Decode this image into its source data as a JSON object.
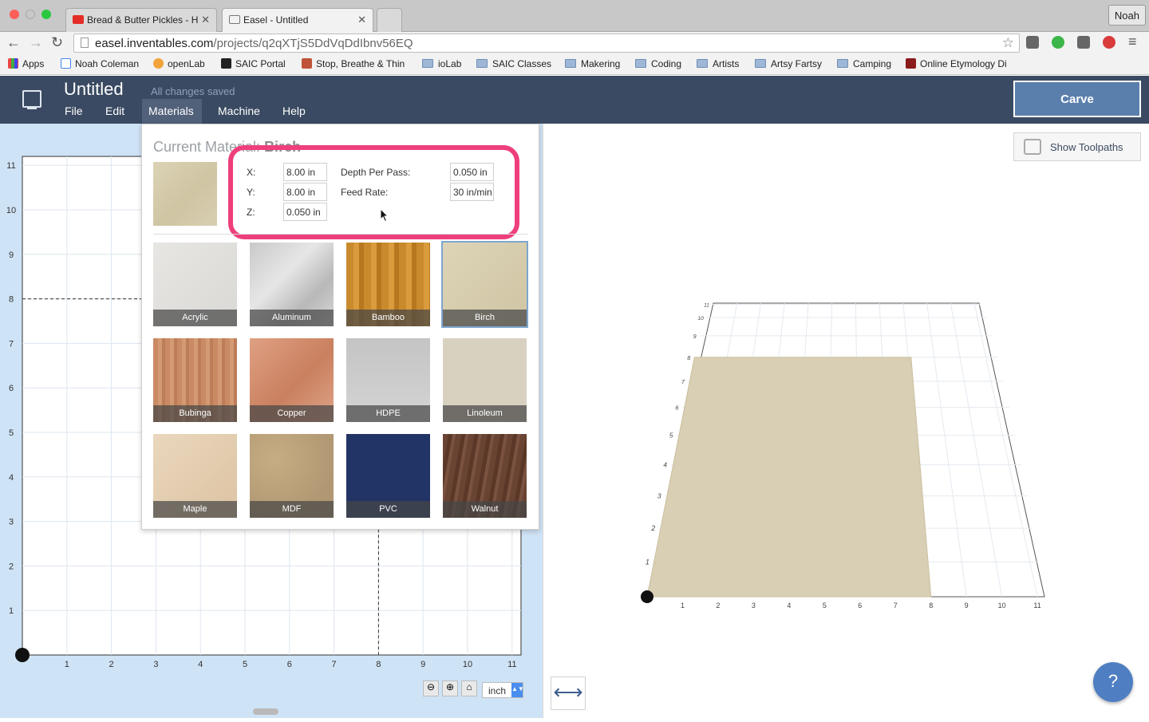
{
  "browser": {
    "tabs": [
      {
        "label": "Bread & Butter Pickles - H",
        "icon_color": "#e52d27"
      },
      {
        "label": "Easel - Untitled"
      }
    ],
    "profile": "Noah",
    "url": {
      "host": "easel.inventables.com",
      "path": "/projects/q2qXTjS5DdVqDdIbnv56EQ"
    },
    "bookmarks": [
      "Apps",
      "Noah Coleman",
      "openLab",
      "SAIC Portal",
      "Stop, Breathe & Thin",
      "ioLab",
      "SAIC Classes",
      "Makering",
      "Coding",
      "Artists",
      "Artsy Fartsy",
      "Camping",
      "Online Etymology Di"
    ]
  },
  "app": {
    "title": "Untitled",
    "save_status": "All changes saved",
    "menu": [
      "File",
      "Edit",
      "Materials",
      "Machine",
      "Help"
    ],
    "carve_label": "Carve",
    "accent": "#3a4a62"
  },
  "materials_panel": {
    "current_label": "Current Material:",
    "current_value": "Birch",
    "fields": {
      "x_label": "X:",
      "x_value": "8.00 in",
      "y_label": "Y:",
      "y_value": "8.00 in",
      "z_label": "Z:",
      "z_value": "0.050 in",
      "depth_label": "Depth Per Pass:",
      "depth_value": "0.050 in",
      "feed_label": "Feed Rate:",
      "feed_value": "30 in/min"
    },
    "materials": [
      "Acrylic",
      "Aluminum",
      "Bamboo",
      "Birch",
      "Bubinga",
      "Copper",
      "HDPE",
      "Linoleum",
      "Maple",
      "MDF",
      "PVC",
      "Walnut"
    ],
    "selected": "Birch"
  },
  "canvas2d": {
    "x_ticks": [
      "1",
      "2",
      "3",
      "4",
      "5",
      "6",
      "7",
      "8",
      "9",
      "10",
      "11"
    ],
    "y_ticks": [
      "1",
      "2",
      "3",
      "4",
      "5",
      "6",
      "7",
      "8",
      "9",
      "10",
      "11"
    ],
    "unit": "inch"
  },
  "preview3d": {
    "show_toolpaths_label": "Show Toolpaths",
    "x_ticks": [
      "1",
      "2",
      "3",
      "4",
      "5",
      "6",
      "7",
      "8",
      "9",
      "10",
      "11"
    ],
    "y_ticks": [
      "1",
      "2",
      "3",
      "4",
      "5",
      "6",
      "7",
      "8",
      "9",
      "10",
      "11"
    ]
  }
}
